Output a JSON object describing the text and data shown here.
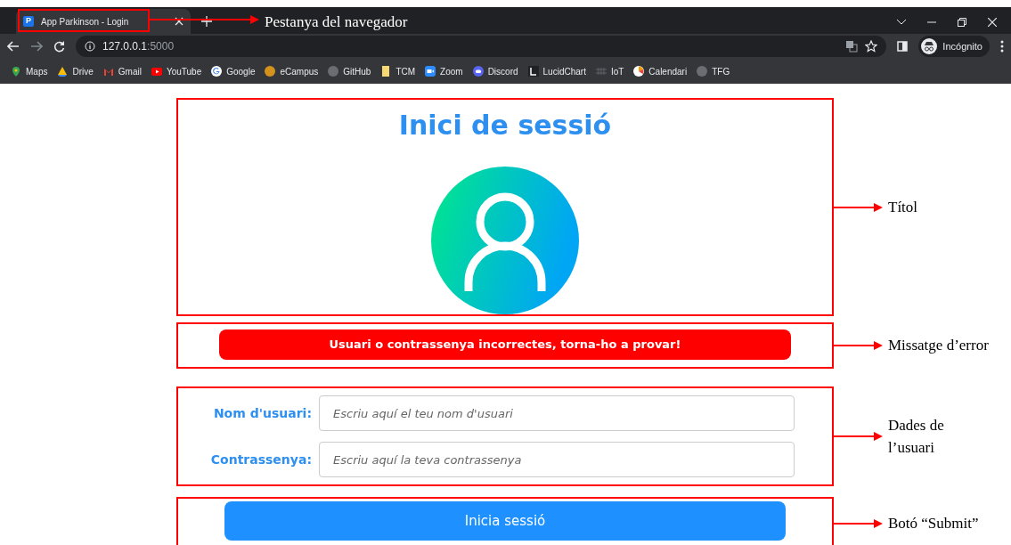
{
  "browser": {
    "tab": {
      "title": "App Parkinson - Login",
      "favicon": "P",
      "selected": true
    },
    "address": {
      "host": "127.0.0.1",
      "port": ":5000"
    },
    "profile": "Incógnito",
    "bookmarks": [
      {
        "label": "Maps"
      },
      {
        "label": "Drive"
      },
      {
        "label": "Gmail"
      },
      {
        "label": "YouTube"
      },
      {
        "label": "Google"
      },
      {
        "label": "eCampus"
      },
      {
        "label": "GitHub"
      },
      {
        "label": "TCM"
      },
      {
        "label": "Zoom"
      },
      {
        "label": "Discord"
      },
      {
        "label": "LucidChart"
      },
      {
        "label": "IoT"
      },
      {
        "label": "Calendari"
      },
      {
        "label": "TFG"
      }
    ]
  },
  "login": {
    "title": "Inici de sessió",
    "error": "Usuari o contrassenya incorrectes, torna-ho a provar!",
    "fields": [
      {
        "label": "Nom d'usuari:",
        "placeholder": "Escriu aquí el teu nom d'usuari"
      },
      {
        "label": "Contrassenya:",
        "placeholder": "Escriu aquí la teva contrassenya"
      }
    ],
    "submit": "Inicia sessió"
  },
  "annotations": [
    {
      "label": "Pestanya del navegador"
    },
    {
      "label": "Títol"
    },
    {
      "label": "Missatge d’error"
    },
    {
      "label": "Dades de l’usuari"
    },
    {
      "label": "Botó “Submit”"
    }
  ]
}
